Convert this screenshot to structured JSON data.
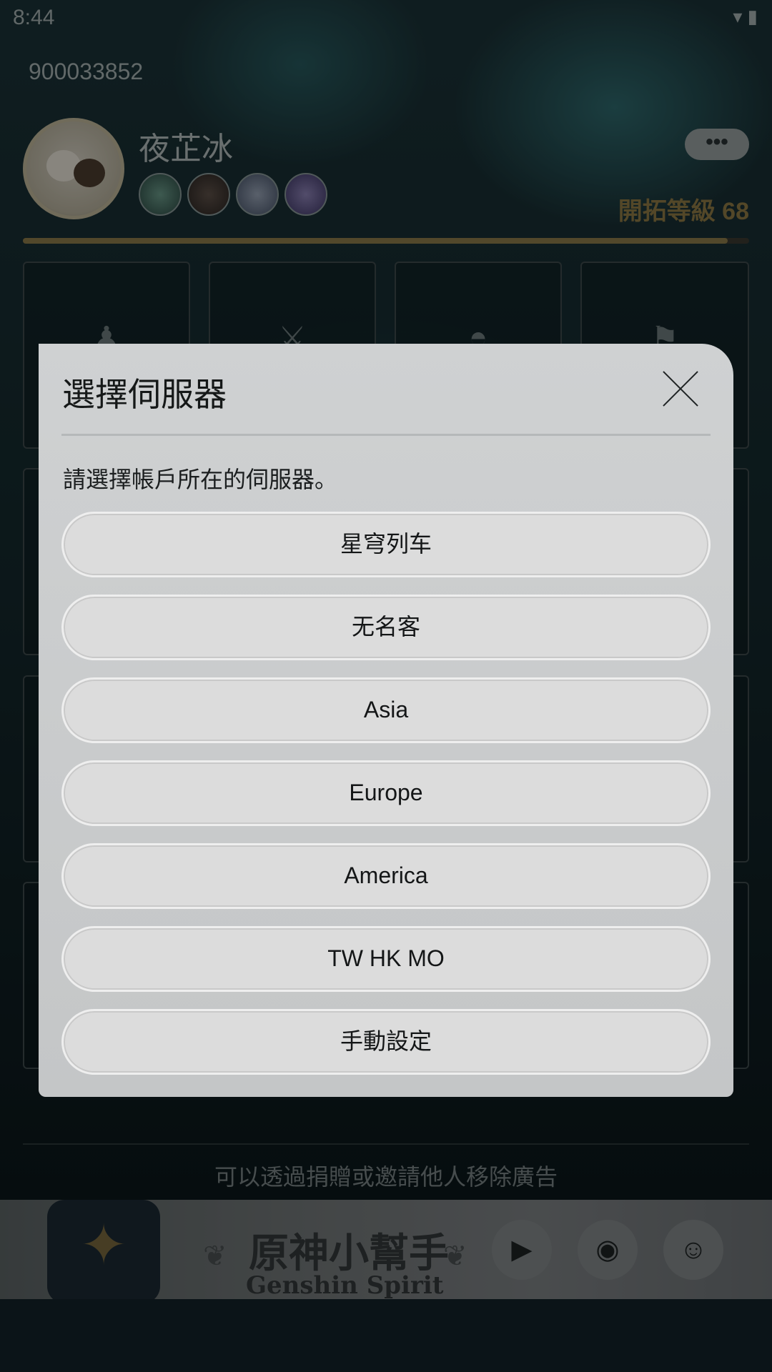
{
  "status_bar": {
    "time": "8:44",
    "icons": "▾ ▮"
  },
  "profile": {
    "uid": "900033852",
    "nickname": "夜芷冰",
    "more_label": "•••",
    "level_label": "開拓等級 68",
    "level_progress": 0.97
  },
  "tiles": {
    "row1_icons": [
      "♟",
      "⚔",
      "◓",
      "⚑"
    ]
  },
  "ad_note": "可以透過捐贈或邀請他人移除廣告",
  "banner": {
    "title": "原神小幫手",
    "subtitle": "Genshin Spirit",
    "logo_icon": "✦",
    "buttons": [
      "▶",
      "◉",
      "☺"
    ]
  },
  "dialog": {
    "title": "選擇伺服器",
    "message": "請選擇帳戶所在的伺服器。",
    "options": [
      "星穹列车",
      "无名客",
      "Asia",
      "Europe",
      "America",
      "TW HK MO",
      "手動設定"
    ]
  }
}
